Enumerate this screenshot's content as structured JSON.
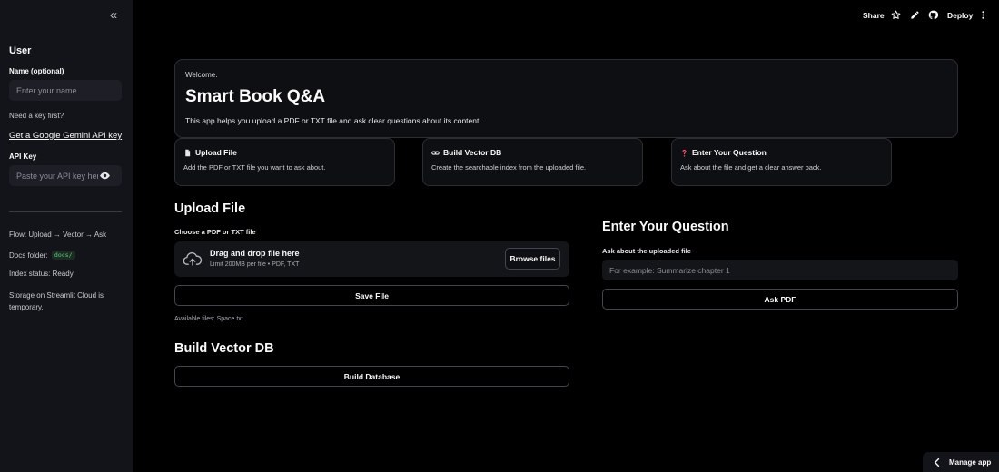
{
  "sidebar": {
    "collapse_glyph": "«",
    "heading": "User",
    "name_label": "Name (optional)",
    "name_placeholder": "Enter your name",
    "need_key": "Need a key first?",
    "gemini_link": "Get a Google Gemini API key",
    "api_key_label": "API Key",
    "api_key_placeholder": "Paste your API key here",
    "flow": "Flow: Upload → Vector → Ask",
    "docs_folder_label": "Docs folder:",
    "docs_folder_value": "docs/",
    "index_status": "Index status: Ready",
    "storage_note": "Storage on Streamlit Cloud is temporary."
  },
  "topbar": {
    "share": "Share",
    "deploy": "Deploy"
  },
  "welcome": {
    "small": "Welcome.",
    "title": "Smart Book Q&A",
    "description": "This app helps you upload a PDF or TXT file and ask clear questions about its content."
  },
  "steps": [
    {
      "title": "Upload File",
      "desc": "Add the PDF or TXT file you want to ask about.",
      "icon": "document-icon"
    },
    {
      "title": "Build Vector DB",
      "desc": "Create the searchable index from the uploaded file.",
      "icon": "link-icon"
    },
    {
      "title": "Enter Your Question",
      "desc": "Ask about the file and get a clear answer back.",
      "icon": "question-icon"
    }
  ],
  "upload": {
    "title": "Upload File",
    "label": "Choose a PDF or TXT file",
    "drop_title": "Drag and drop file here",
    "drop_sub": "Limit 200MB per file • PDF, TXT",
    "browse": "Browse files",
    "save": "Save File",
    "available": "Available files: Space.txt"
  },
  "vector": {
    "title": "Build Vector DB",
    "build": "Build Database"
  },
  "question": {
    "title": "Enter Your Question",
    "label": "Ask about the uploaded file",
    "placeholder": "For example: Summarize chapter 1",
    "ask": "Ask PDF"
  },
  "footer": {
    "manage_app": "Manage app"
  },
  "colors": {
    "background": "#000000",
    "sidebar": "#131419",
    "card_border": "#2b2d33",
    "question_icon": "#ff4b6e",
    "code_chip": "#4fd680"
  }
}
